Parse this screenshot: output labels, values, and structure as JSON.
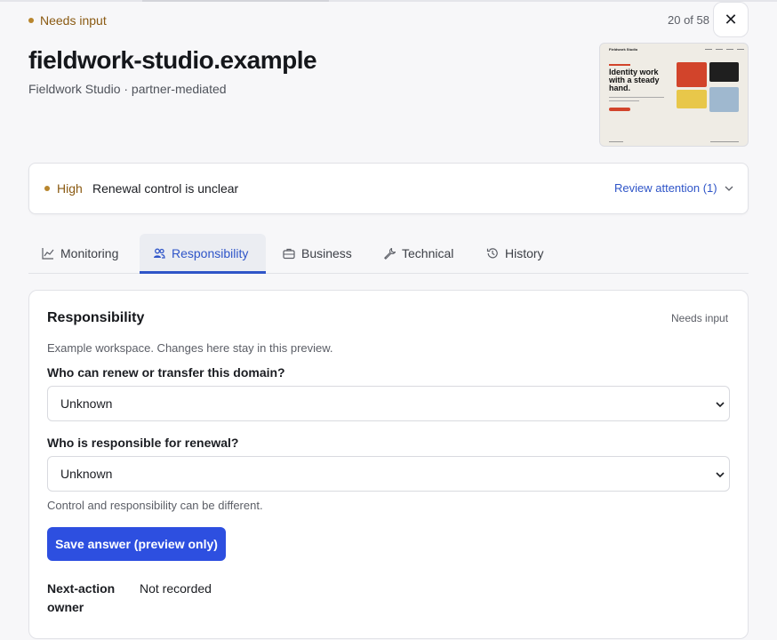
{
  "header": {
    "status": "Needs input",
    "counter": "20 of 58",
    "close_icon": "close-icon",
    "title": "fieldwork-studio.example",
    "subtitle": "Fieldwork Studio · partner-mediated"
  },
  "preview": {
    "brand": "Fieldwork Studio",
    "headline": "Identity work with a steady hand."
  },
  "alert": {
    "severity": "High",
    "message": "Renewal control is unclear",
    "review_label": "Review attention (1)"
  },
  "tabs": [
    {
      "label": "Monitoring",
      "icon": "chart-line-icon"
    },
    {
      "label": "Responsibility",
      "icon": "users-icon"
    },
    {
      "label": "Business",
      "icon": "briefcase-icon"
    },
    {
      "label": "Technical",
      "icon": "wrench-icon"
    },
    {
      "label": "History",
      "icon": "history-icon"
    }
  ],
  "active_tab": "Responsibility",
  "panel": {
    "title": "Responsibility",
    "status": "Needs input",
    "note": "Example workspace. Changes here stay in this preview.",
    "q1_label": "Who can renew or transfer this domain?",
    "q1_value": "Unknown",
    "q2_label": "Who is responsible for renewal?",
    "q2_value": "Unknown",
    "hint": "Control and responsibility can be different.",
    "save_label": "Save answer (preview only)",
    "next_action_key": "Next-action owner",
    "next_action_value": "Not recorded"
  },
  "colors": {
    "accent": "#2d4fe0",
    "warning": "#8a5a12",
    "tab_active": "#2f55c8"
  }
}
